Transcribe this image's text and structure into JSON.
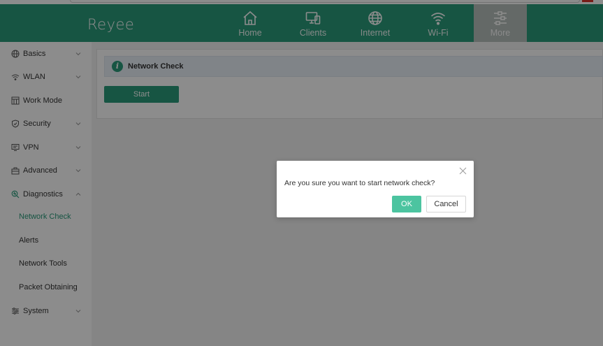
{
  "header": {
    "logo": "Reyee",
    "nav": [
      {
        "label": "Home",
        "icon": "home-icon"
      },
      {
        "label": "Clients",
        "icon": "clients-icon"
      },
      {
        "label": "Internet",
        "icon": "globe-icon"
      },
      {
        "label": "Wi-Fi",
        "icon": "wifi-icon"
      },
      {
        "label": "More",
        "icon": "sliders-icon",
        "active": true
      }
    ]
  },
  "sidebar": {
    "items": [
      {
        "label": "Basics",
        "icon": "globe-icon",
        "expandable": true
      },
      {
        "label": "WLAN",
        "icon": "wifi-icon",
        "expandable": true
      },
      {
        "label": "Work Mode",
        "icon": "workmode-icon",
        "expandable": false
      },
      {
        "label": "Security",
        "icon": "shield-icon",
        "expandable": true
      },
      {
        "label": "VPN",
        "icon": "vpn-icon",
        "expandable": true
      },
      {
        "label": "Advanced",
        "icon": "toolbox-icon",
        "expandable": true
      },
      {
        "label": "Diagnostics",
        "icon": "diagnostics-icon",
        "expandable": true,
        "expanded": true
      },
      {
        "label": "System",
        "icon": "system-icon",
        "expandable": true
      }
    ],
    "sub_items": [
      {
        "label": "Network Check",
        "active": true
      },
      {
        "label": "Alerts"
      },
      {
        "label": "Network Tools"
      },
      {
        "label": "Packet Obtaining"
      }
    ]
  },
  "main": {
    "info_title": "Network Check",
    "info_icon": "i",
    "start_label": "Start"
  },
  "dialog": {
    "message": "Are you sure you want to start network check?",
    "ok_label": "OK",
    "cancel_label": "Cancel"
  },
  "colors": {
    "brand": "#2a9b7b",
    "ok_button": "#4cc4a0",
    "active_tab": "#b7bfbc"
  }
}
